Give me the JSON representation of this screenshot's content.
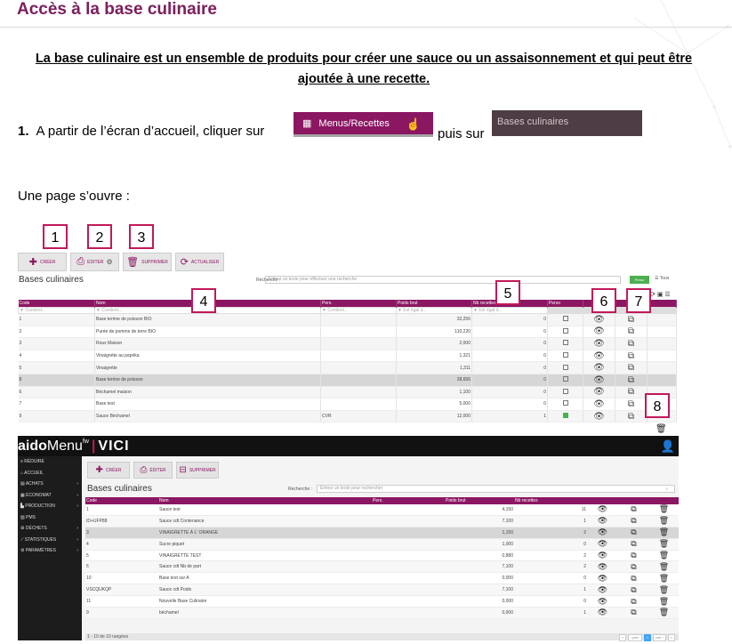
{
  "doc": {
    "title": "Accès à la base culinaire",
    "intro": "La base culinaire est un ensemble de produits pour créer une sauce ou un assaisonnement et qui peut être ajoutée à une recette.",
    "step_number": "1.",
    "step_text": "A partir de l’écran d’accueil, cliquer sur",
    "menus_button": "Menus/Recettes",
    "puis_sur": "puis sur",
    "bases_button": "Bases culinaires",
    "page_opens": "Une page s’ouvre :"
  },
  "callouts": [
    "1",
    "2",
    "3",
    "4",
    "5",
    "6",
    "7",
    "8"
  ],
  "shot1": {
    "toolbar": {
      "creer": "CRÉER",
      "editer": "ÉDITER",
      "supprimer": "SUPPRIMER",
      "actualiser": "ACTUALISER"
    },
    "title": "Bases culinaires",
    "search_label": "Recherche :",
    "search_placeholder": "Entrez un texte pour effectuer une recherche",
    "pers_button": "Perso",
    "tous_button": "Tous",
    "headers": [
      "Code",
      "Nom",
      "Pers.",
      "Poids brut",
      "Nb recettes",
      "Perso"
    ],
    "filters": [
      "▼ Contient...",
      "▼ Contient...",
      "▼ Contient...",
      "▼ Est égal à...",
      "▼ Est égal à..."
    ],
    "rows": [
      {
        "code": "1",
        "nom": "Base terrine de poisson BIO",
        "pers": "",
        "poids": "32,256",
        "nb": "0",
        "perso": false
      },
      {
        "code": "2",
        "nom": "Purée de pomme de terre BIO",
        "pers": "",
        "poids": "110,220",
        "nb": "0",
        "perso": false
      },
      {
        "code": "3",
        "nom": "Roux Maison",
        "pers": "",
        "poids": "2,000",
        "nb": "0",
        "perso": false
      },
      {
        "code": "4",
        "nom": "Vinaigrette au paprika",
        "pers": "",
        "poids": "1,321",
        "nb": "0",
        "perso": false
      },
      {
        "code": "5",
        "nom": "Vinaigrette",
        "pers": "",
        "poids": "1,311",
        "nb": "0",
        "perso": false
      },
      {
        "code": "8",
        "nom": "Base terrine de poisson",
        "pers": "",
        "poids": "28,656",
        "nb": "0",
        "perso": false
      },
      {
        "code": "6",
        "nom": "Béchamel maison",
        "pers": "",
        "poids": "1,100",
        "nb": "0",
        "perso": false
      },
      {
        "code": "7",
        "nom": "Base test",
        "pers": "",
        "poids": "5,000",
        "nb": "0",
        "perso": false
      },
      {
        "code": "9",
        "nom": "Sauce Béchamel",
        "pers": "CVR",
        "poids": "12,000",
        "nb": "1",
        "perso": true
      }
    ]
  },
  "shot2": {
    "logo_a": "aido",
    "logo_b": "Menu",
    "logo_sup": "fw",
    "logo_sep": "|",
    "logo_vici": "VICI",
    "sidebar": [
      {
        "label": "≡ RÉDUIRE",
        "arrow": ""
      },
      {
        "label": "⌂ ACCUEIL",
        "arrow": ""
      },
      {
        "label": "▤ ACHATS",
        "arrow": "›"
      },
      {
        "label": "▦ ÉCONOMAT",
        "arrow": "›"
      },
      {
        "label": "▙ PRODUCTION",
        "arrow": "›"
      },
      {
        "label": "▨ PMS",
        "arrow": ""
      },
      {
        "label": "♻ DÉCHETS",
        "arrow": "›"
      },
      {
        "label": "⟋ STATISTIQUES",
        "arrow": "›"
      },
      {
        "label": "⚙ PARAMÈTRES",
        "arrow": "›"
      }
    ],
    "toolbar": {
      "creer": "CRÉER",
      "editer": "ÉDITER",
      "supprimer": "SUPPRIMER"
    },
    "title": "Bases culinaires",
    "search_label": "Recherche :",
    "search_placeholder": "Entrez un texte pour rechercher",
    "headers": [
      "Code",
      "Nom",
      "Pers.",
      "Poids brut",
      "Nb recettes"
    ],
    "rows": [
      {
        "code": "1",
        "nom": "Sauce test",
        "pers": "",
        "poids": "4,150",
        "nb": "11"
      },
      {
        "code": "ID+UFP88",
        "nom": "Sauce cdt Contenance",
        "pers": "",
        "poids": "7,100",
        "nb": "1"
      },
      {
        "code": "3",
        "nom": "VINAIGRETTE À L' ORANGE",
        "pers": "",
        "poids": "1,150",
        "nb": "2"
      },
      {
        "code": "4",
        "nom": "Sucre piquet",
        "pers": "",
        "poids": "1,000",
        "nb": "0"
      },
      {
        "code": "5",
        "nom": "VINAIGRETTE TEST",
        "pers": "",
        "poids": "0,880",
        "nb": "2"
      },
      {
        "code": "6",
        "nom": "Sauce cdt Nb de part",
        "pers": "",
        "poids": "7,100",
        "nb": "2"
      },
      {
        "code": "10",
        "nom": "Base test sur A",
        "pers": "",
        "poids": "0,000",
        "nb": "0"
      },
      {
        "code": "VSCQUKQP",
        "nom": "Sauce cdt Poids",
        "pers": "",
        "poids": "7,100",
        "nb": "1"
      },
      {
        "code": "11",
        "nom": "Nouvelle Base Culinaire",
        "pers": "",
        "poids": "0,000",
        "nb": "0"
      },
      {
        "code": "9",
        "nom": "béchamel",
        "pers": "",
        "poids": "0,000",
        "nb": "1"
      }
    ],
    "footer": "1 - 10 de 10 rangées",
    "pager": [
      "«",
      "‹ préc.",
      "1",
      "suiv. ›",
      "»"
    ]
  }
}
